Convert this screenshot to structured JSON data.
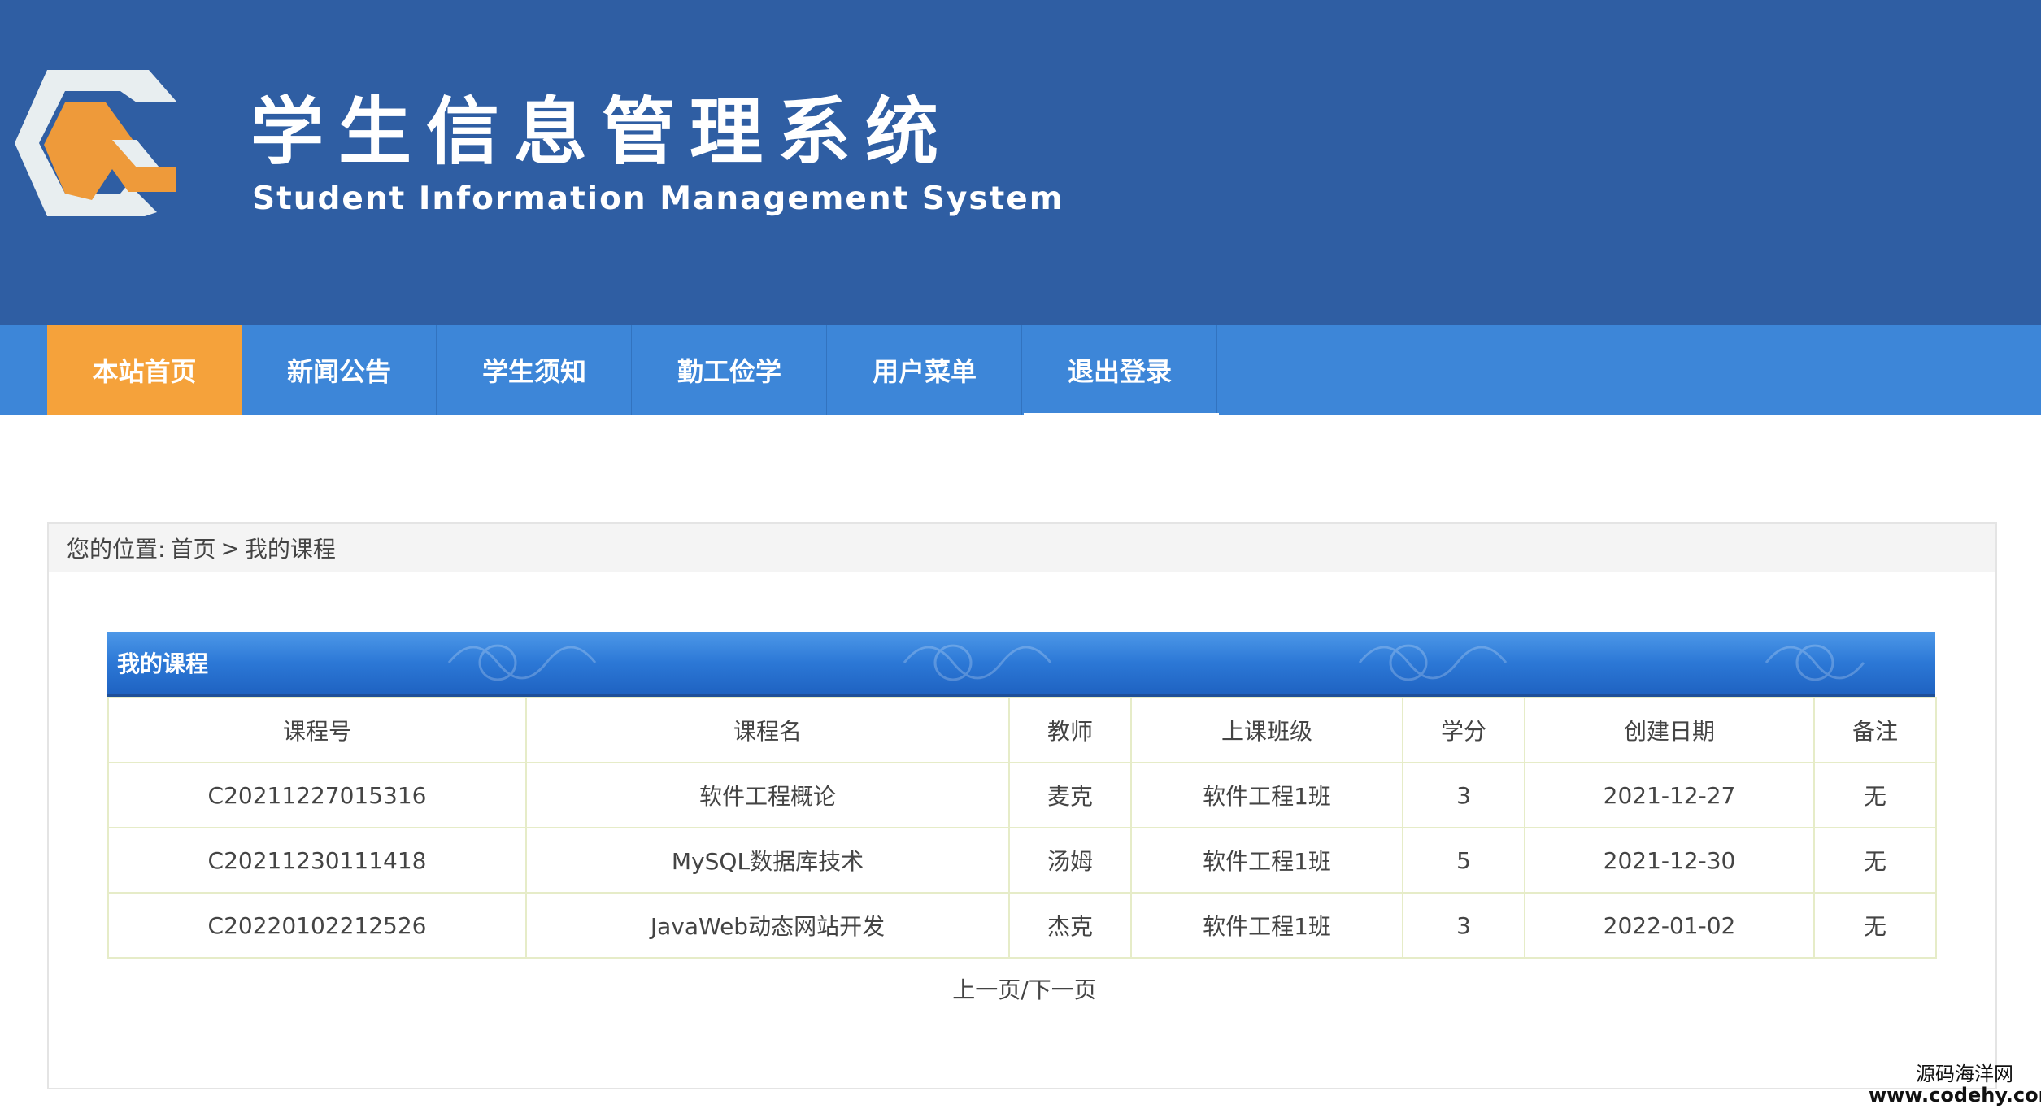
{
  "header": {
    "title": "学生信息管理系统",
    "subtitle": "Student Information Management System",
    "colors": {
      "background": "#2f5ea3",
      "logo_orange": "#ee9a3a",
      "logo_light": "#e8eef0"
    }
  },
  "nav": {
    "items": [
      {
        "label": "本站首页",
        "active": true
      },
      {
        "label": "新闻公告",
        "active": false
      },
      {
        "label": "学生须知",
        "active": false
      },
      {
        "label": "勤工俭学",
        "active": false
      },
      {
        "label": "用户菜单",
        "active": false
      },
      {
        "label": "退出登录",
        "active": false
      }
    ],
    "colors": {
      "bar": "#3d86d8",
      "active": "#f5a23b"
    }
  },
  "breadcrumb": {
    "prefix": "您的位置:",
    "home": "首页",
    "separator": ">",
    "current": "我的课程"
  },
  "courses_table": {
    "title": "我的课程",
    "columns": [
      "课程号",
      "课程名",
      "教师",
      "上课班级",
      "学分",
      "创建日期",
      "备注"
    ],
    "rows": [
      [
        "C20211227015316",
        "软件工程概论",
        "麦克",
        "软件工程1班",
        "3",
        "2021-12-27",
        "无"
      ],
      [
        "C20211230111418",
        "MySQL数据库技术",
        "汤姆",
        "软件工程1班",
        "5",
        "2021-12-30",
        "无"
      ],
      [
        "C20220102212526",
        "JavaWeb动态网站开发",
        "杰克",
        "软件工程1班",
        "3",
        "2022-01-02",
        "无"
      ]
    ]
  },
  "pager": {
    "prev": "上一页",
    "separator": "/",
    "next": "下一页"
  },
  "watermark": {
    "line1": "源码海洋网",
    "line2": "www.codehy.com"
  }
}
